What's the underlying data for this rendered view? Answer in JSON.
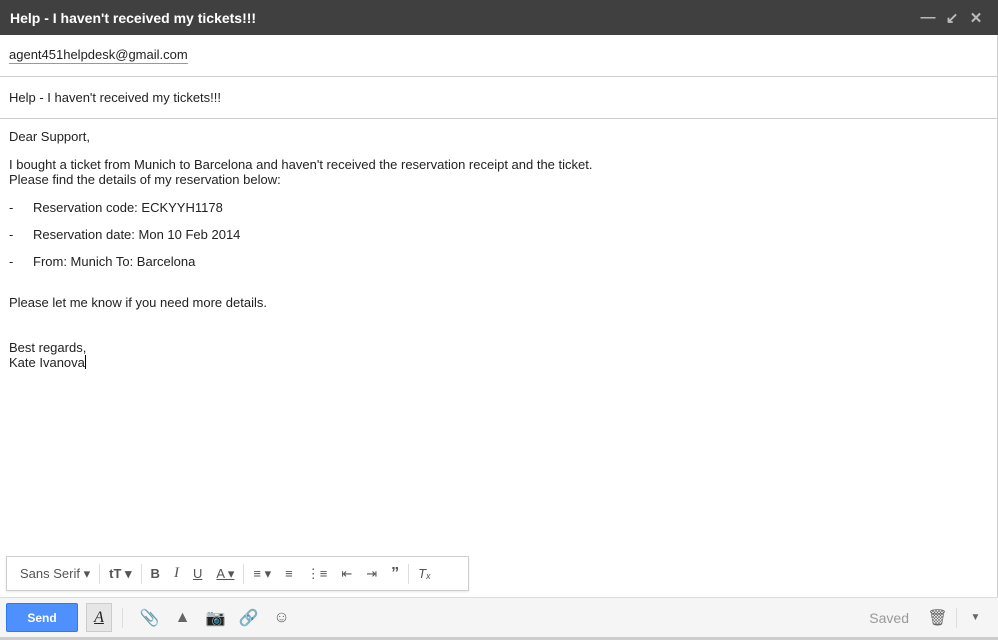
{
  "window": {
    "title": "Help - I haven't received my tickets!!!"
  },
  "to": "agent451helpdesk@gmail.com",
  "subject": "Help - I haven't received my tickets!!!",
  "body": {
    "greeting": "Dear Support,",
    "line1": "I bought a ticket from Munich to Barcelona and haven't received the reservation receipt and the ticket.",
    "line2": "Please find the details of my reservation below:",
    "items": [
      {
        "dash": "-",
        "text": "Reservation code: ECKYYH1178"
      },
      {
        "dash": "-",
        "text": "Reservation date: Mon 10 Feb 2014"
      },
      {
        "dash": "-",
        "text": "From: Munich To: Barcelona"
      }
    ],
    "closing": "Please let me know if you need more details.",
    "regards": "Best regards,",
    "signature": "Kate Ivanova"
  },
  "format": {
    "font": "Sans Serif"
  },
  "bottom": {
    "send": "Send",
    "status": "Saved"
  }
}
